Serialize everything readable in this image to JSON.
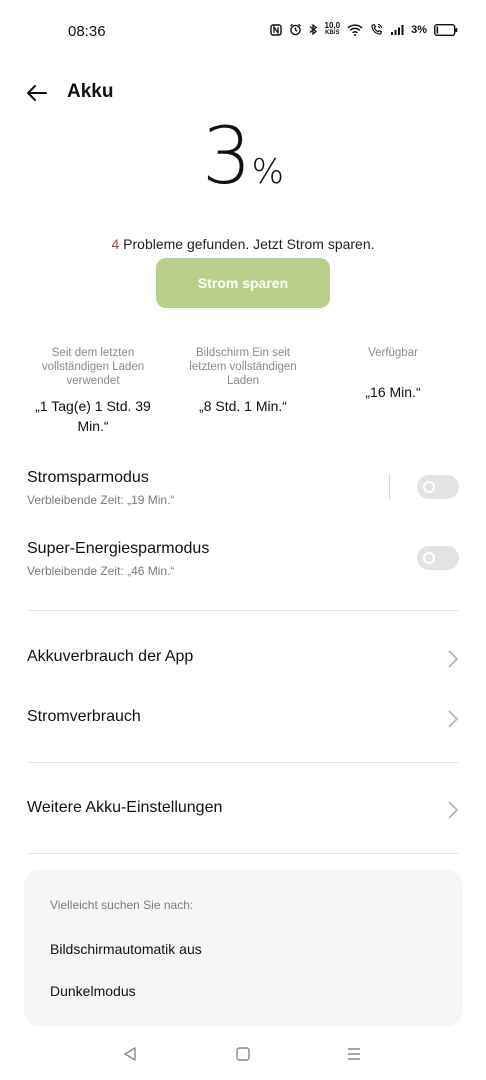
{
  "status_bar": {
    "time": "08:36",
    "speed_value": "10,0",
    "speed_unit": "KB/S",
    "battery_percent": "3%"
  },
  "header": {
    "title": "Akku",
    "back_icon": "arrow-left-icon"
  },
  "battery": {
    "level": "3",
    "unit": "%"
  },
  "problems": {
    "count": "4",
    "text": " Probleme gefunden. Jetzt Strom sparen."
  },
  "save_button": {
    "label": "Strom sparen",
    "color": "#b9d08b"
  },
  "stats": [
    {
      "label": "Seit dem letzten vollständigen Laden verwendet",
      "value": "„1 Tag(e) 1 Std. 39 Min.“"
    },
    {
      "label": "Bildschirm Ein seit letztem vollständigen Laden",
      "value": "„8 Std. 1 Min.“"
    },
    {
      "label": "Verfügbar",
      "value": "„16 Min.“"
    }
  ],
  "modes": [
    {
      "title": "Stromsparmodus",
      "subtitle": "Verbleibende Zeit:  „19 Min.“",
      "enabled": false
    },
    {
      "title": "Super-Energiesparmodus",
      "subtitle": "Verbleibende Zeit:  „46 Min.“",
      "enabled": false
    }
  ],
  "menu": {
    "app_usage": "Akkuverbrauch der App",
    "power_usage": "Stromverbrauch",
    "more_settings": "Weitere Akku-Einstellungen"
  },
  "suggestions": {
    "heading": "Vielleicht suchen Sie nach:",
    "items": [
      "Bildschirmautomatik aus",
      "Dunkelmodus"
    ]
  },
  "nav_bar": {
    "back_icon": "triangle-back-icon",
    "home_icon": "square-home-icon",
    "menu_icon": "hamburger-menu-icon"
  }
}
